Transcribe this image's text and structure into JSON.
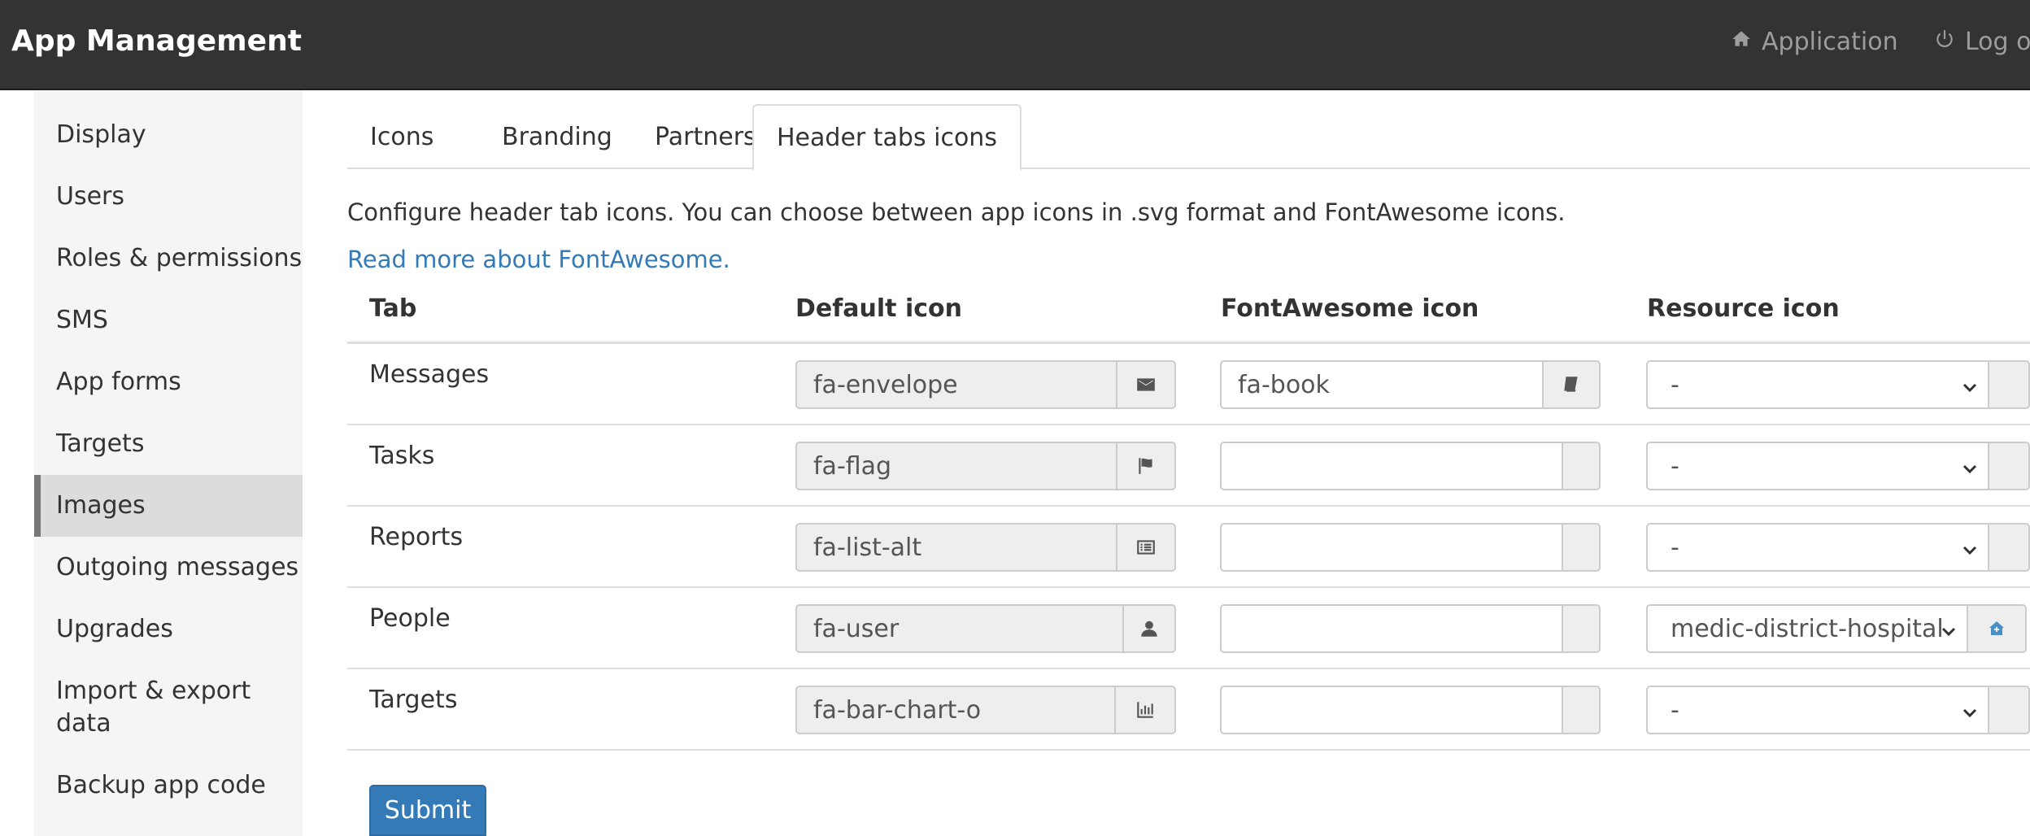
{
  "app": {
    "title": "App Management"
  },
  "navbar": {
    "application_label": "Application",
    "logout_label": "Log out"
  },
  "sidebar": {
    "items": [
      {
        "label": "Display"
      },
      {
        "label": "Users"
      },
      {
        "label": "Roles & permissions"
      },
      {
        "label": "SMS"
      },
      {
        "label": "App forms"
      },
      {
        "label": "Targets"
      },
      {
        "label": "Images",
        "active": true
      },
      {
        "label": "Outgoing messages"
      },
      {
        "label": "Upgrades"
      },
      {
        "label": "Import & export\ndata"
      },
      {
        "label": "Backup app code"
      }
    ]
  },
  "tabs": [
    {
      "label": "Icons"
    },
    {
      "label": "Branding"
    },
    {
      "label": "Partners"
    },
    {
      "label": "Header tabs icons",
      "active": true
    }
  ],
  "main": {
    "description": "Configure header tab icons. You can choose between app icons in .svg format and FontAwesome icons.",
    "read_more_link": "Read more about FontAwesome.",
    "submit_label": "Submit"
  },
  "table": {
    "headers": {
      "tab": "Tab",
      "default_icon": "Default icon",
      "fontawesome_icon": "FontAwesome icon",
      "resource_icon": "Resource icon"
    },
    "rows": [
      {
        "tab": "Messages",
        "default_icon": "fa-envelope",
        "default_icon_glyph": "envelope-icon",
        "fontawesome_icon": "fa-book",
        "fontawesome_glyph": "book-icon",
        "resource_icon": "-"
      },
      {
        "tab": "Tasks",
        "default_icon": "fa-flag",
        "default_icon_glyph": "flag-icon",
        "fontawesome_icon": "",
        "fontawesome_glyph": "",
        "resource_icon": "-"
      },
      {
        "tab": "Reports",
        "default_icon": "fa-list-alt",
        "default_icon_glyph": "list-alt-icon",
        "fontawesome_icon": "",
        "fontawesome_glyph": "",
        "resource_icon": "-"
      },
      {
        "tab": "People",
        "default_icon": "fa-user",
        "default_icon_glyph": "user-icon",
        "fontawesome_icon": "",
        "fontawesome_glyph": "",
        "resource_icon": "medic-district-hospital",
        "resource_glyph": "hospital-icon"
      },
      {
        "tab": "Targets",
        "default_icon": "fa-bar-chart-o",
        "default_icon_glyph": "bar-chart-icon",
        "fontawesome_icon": "",
        "fontawesome_glyph": "",
        "resource_icon": "-"
      }
    ]
  },
  "colors": {
    "navbar_bg": "#333333",
    "link": "#337ab7",
    "primary_button": "#337ab7",
    "sidebar_active": "#dcdcdc"
  }
}
